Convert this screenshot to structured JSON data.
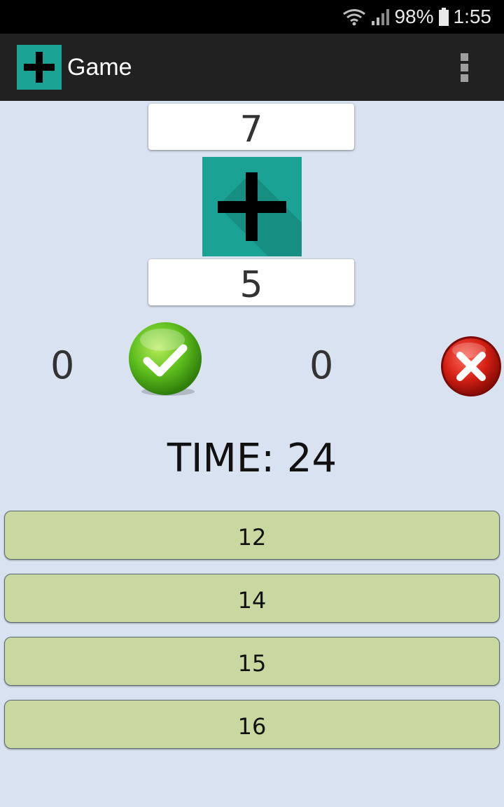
{
  "status_bar": {
    "battery_percent": "98%",
    "time": "1:55",
    "icons": [
      "wifi-icon",
      "signal-icon",
      "battery-icon"
    ]
  },
  "app_bar": {
    "title": "Game",
    "icon": "plus-icon",
    "menu_icon": "overflow-menu-icon",
    "bar_color": "#212121"
  },
  "problem": {
    "first_operand": "7",
    "operator_icon": "plus-icon",
    "second_operand": "5",
    "tile_color": "#1aa394"
  },
  "scores": {
    "correct_count": "0",
    "correct_icon": "checkmark-icon",
    "wrong_count": "0",
    "wrong_icon": "cross-icon"
  },
  "timer": {
    "label": "TIME:",
    "value": "24"
  },
  "answers": [
    {
      "label": "12"
    },
    {
      "label": "14"
    },
    {
      "label": "15"
    },
    {
      "label": "16"
    }
  ],
  "colors": {
    "background": "#d9e2f0",
    "answer_button": "#c8d8a0",
    "accent": "#1aa394"
  }
}
